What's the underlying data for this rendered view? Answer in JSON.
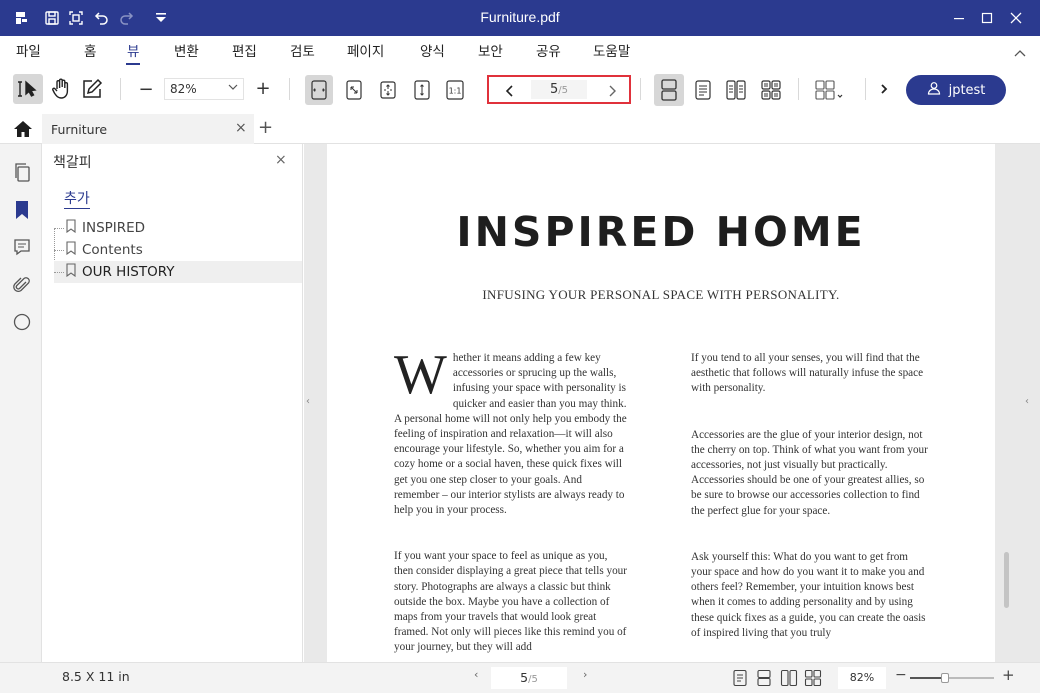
{
  "window": {
    "title": "Furniture.pdf"
  },
  "menu": {
    "items": [
      "파일",
      "홈",
      "뷰",
      "변환",
      "편집",
      "검토",
      "페이지",
      "양식",
      "보안",
      "공유",
      "도움말"
    ],
    "active": "뷰"
  },
  "toolbar": {
    "zoom": "82%",
    "page_current": "5",
    "page_total": "/5",
    "user": "jptest"
  },
  "tab": {
    "label": "Furniture",
    "close": "×",
    "add": "+"
  },
  "sidebar": {
    "title": "책갈피",
    "close": "×",
    "add_label": "추가",
    "bookmarks": [
      "INSPIRED",
      "Contents",
      "OUR HISTORY"
    ],
    "selected": "OUR HISTORY"
  },
  "document": {
    "heading": "INSPIRED HOME",
    "subtitle": "INFUSING YOUR PERSONAL SPACE WITH PERSONALITY.",
    "dropcap": "W",
    "col1_p1": "hether it means adding a few key accessories or sprucing up the walls, infusing your space with personality is quicker and easier than you may think. A personal home will not only help you embody the feeling of inspiration and relaxation—it will also encourage your lifestyle. So, whether you aim for a cozy home or a social haven, these quick fixes will get you one step closer to your goals. And remember – our interior stylists are always ready to help you in your process.",
    "col1_p2": "If you want your space to feel as unique as you, then consider displaying a great piece that tells your story. Photographs are always a classic but think outside the box. Maybe you have a collection of maps from your travels that would look great framed. Not only will pieces like this remind you of your journey, but they will add",
    "col2_p1": "If you tend to all your senses, you will find that the aesthetic that follows will naturally infuse the space with personality.",
    "col2_p2": "Accessories are the glue of your interior design, not the cherry on top. Think of what you want from your accessories, not just visually but practically. Accessories should be one of your greatest allies, so be sure to browse our accessories collection to find the perfect glue for your space.",
    "col2_p3": "Ask yourself this: What do you want to get from your space and how do you want it to make you and others feel? Remember, your intuition knows best when it comes to adding personality and by using these quick fixes as a guide, you can create the oasis of inspired living that you truly"
  },
  "status": {
    "page_size": "8.5 X 11 in",
    "page_current": "5",
    "page_total": "/5",
    "zoom": "82%",
    "zoom_level": 0.42
  },
  "colors": {
    "brand": "#2b3a8f",
    "highlight": "#e0313b"
  }
}
